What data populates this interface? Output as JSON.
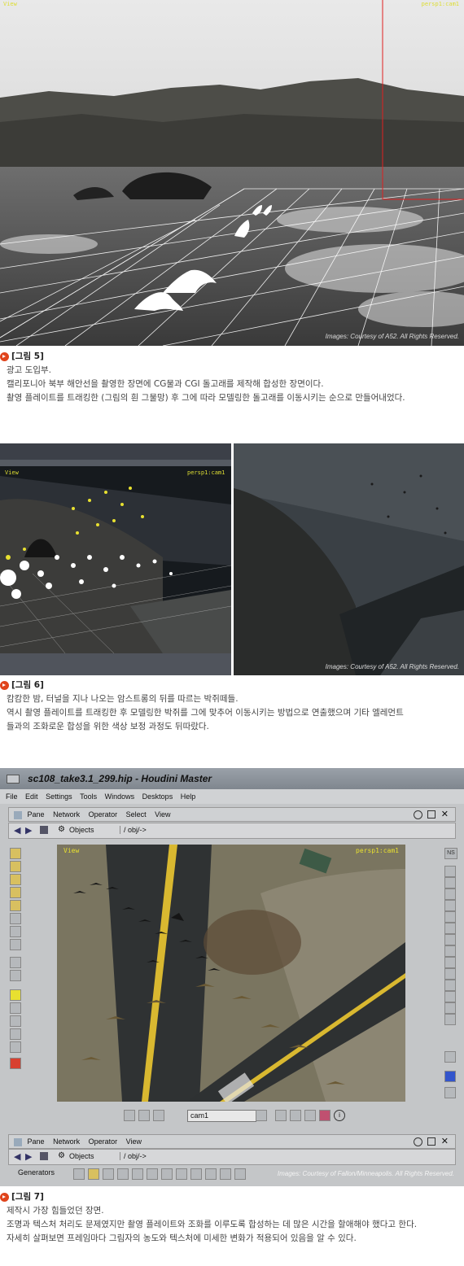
{
  "figure5": {
    "vp_left": "View",
    "vp_right": "persp1:cam1",
    "credit": "Images: Courtesy of A52. All Rights Reserved.",
    "title": "[그림 5]",
    "lines": [
      "광고 도입부.",
      "캘리포니아 북부 해안선을 촬영한 장면에 CG물과 CGI 돌고래를 제작해 합성한 장면이다.",
      "촬영 플레이트를 트래킹한 (그림의 흰 그물망) 후 그에 따라 모델링한 돌고래를 이동시키는 순으로 만들어내었다."
    ]
  },
  "figure6": {
    "vp_left": "View",
    "vp_right": "persp1:cam1",
    "credit": "Images: Courtesy of A52. All Rights Reserved.",
    "title": "[그림 6]",
    "lines": [
      "캄캄한 밤, 터널을 지나 나오는 암스트롱의 뒤를 따르는 박쥐떼들.",
      "역시 촬영 플레이트를 트래킹한 후 모델링한 박쥐를 그에 맞추어 이동시키는 방법으로 연출했으며 기타 엘레먼트",
      "들과의 조화로운 합성을 위한 색상 보정 과정도 뒤따랐다."
    ]
  },
  "houdini": {
    "window_title": "sc108_take3.1_299.hip - Houdini Master",
    "menu": [
      "File",
      "Edit",
      "Settings",
      "Tools",
      "Windows",
      "Desktops",
      "Help"
    ],
    "pane_menu": [
      "Pane",
      "Network",
      "Operator",
      "Select",
      "View"
    ],
    "objects_label": "Objects",
    "path": "/ obj/->",
    "vp_left": "View",
    "vp_right": "persp1:cam1",
    "camera": "cam1",
    "ns_label": "NS",
    "pane2_menu": [
      "Pane",
      "Network",
      "Operator",
      "View"
    ],
    "objects_label2": "Objects",
    "path2": "/ obj/->",
    "generators": "Generators",
    "credit": "Images: Courtesy of Fallon/Minneapolis. All Rights Reserved."
  },
  "figure7": {
    "title": "[그림 7]",
    "lines": [
      "제작시 가장 힘들었던 장면.",
      "조명과 텍스처 처리도 문제였지만 촬영 플레이트와 조화를 이루도록 합성하는 데 많은 시간을 할애해야 했다고 한다.",
      "자세히 살펴보면 프레임마다 그림자의 농도와 텍스처에 미세한 변화가 적용되어 있음을 알 수 있다."
    ]
  },
  "colors": {
    "accent": "#e0441c",
    "guide_red": "#e02020",
    "hou_yellow": "#e8e030"
  }
}
